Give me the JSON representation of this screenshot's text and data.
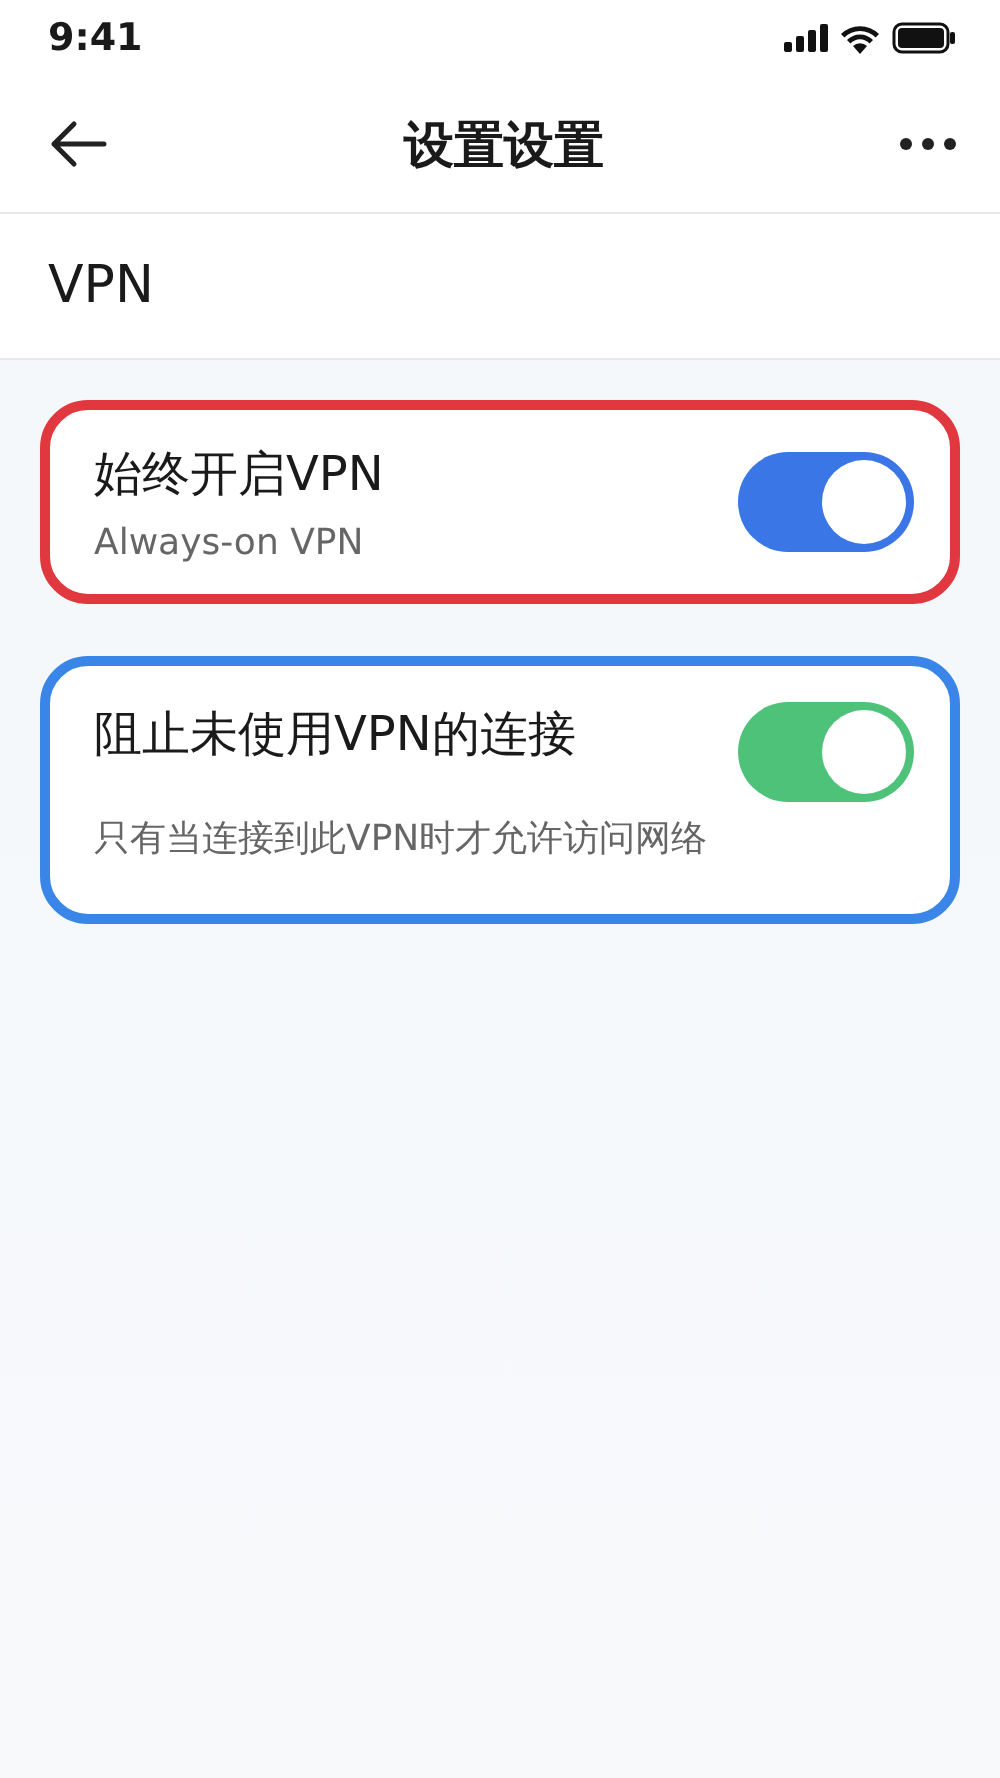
{
  "status_bar": {
    "time": "9:41"
  },
  "header": {
    "title": "设置设置"
  },
  "section": {
    "title": "VPN"
  },
  "settings": [
    {
      "title": "始终开启VPN",
      "subtitle": "Always-on VPN",
      "color": "#e0383e",
      "toggle": {
        "on": true,
        "color": "#3b76e6"
      }
    },
    {
      "title": "阻止未使用VPN的连接",
      "subtitle": "只有当连接到此VPN时才允许访问网络",
      "color": "#3a86e8",
      "toggle": {
        "on": true,
        "color": "#4fc27a"
      }
    }
  ]
}
